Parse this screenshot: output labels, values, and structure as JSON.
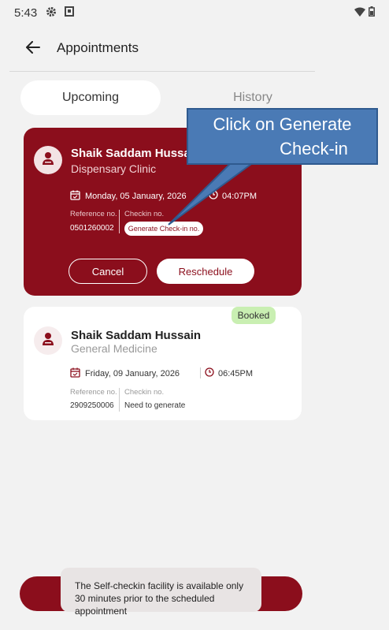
{
  "status_bar": {
    "time": "5:43",
    "icons": [
      "gear-icon",
      "notification-icon",
      "wifi-icon",
      "battery-icon"
    ]
  },
  "header": {
    "title": "Appointments",
    "back_icon": "arrow-left-icon"
  },
  "tabs": [
    {
      "label": "Upcoming",
      "active": true
    },
    {
      "label": "History",
      "active": false
    }
  ],
  "callout": {
    "text_line1": "Click on Generate",
    "text_line2": "Check-in"
  },
  "appointments": [
    {
      "patient_name": "Shaik Saddam Hussain",
      "department": "Dispensary Clinic",
      "date": "Monday, 05 January, 2026",
      "time": "04:07PM",
      "reference_label": "Reference no.",
      "reference_no": "0501260002",
      "checkin_label": "Checkin no.",
      "checkin_action": "Generate Check-in no.",
      "cancel_label": "Cancel",
      "reschedule_label": "Reschedule"
    },
    {
      "patient_name": "Shaik Saddam Hussain",
      "department": "General Medicine",
      "status": "Booked",
      "date": "Friday, 09 January, 2026",
      "time": "06:45PM",
      "reference_label": "Reference no.",
      "reference_no": "2909250006",
      "checkin_label": "Checkin no.",
      "checkin_value": "Need to generate"
    }
  ],
  "toast": {
    "message": "The Self-checkin facility is available only 30 minutes prior to the scheduled appointment"
  },
  "colors": {
    "primary": "#8b0e1c",
    "background": "#f2f2f2",
    "badge_booked": "#c9efb2",
    "callout": "#4a7ab5"
  }
}
